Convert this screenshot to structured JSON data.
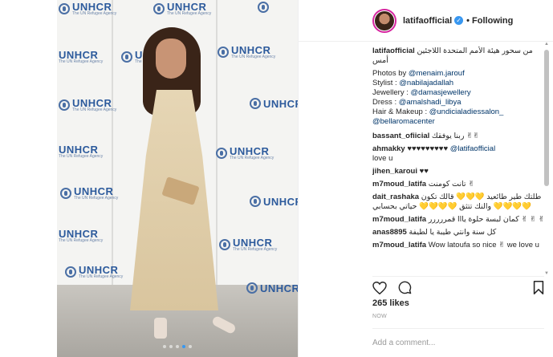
{
  "post": {
    "username": "latifaofficial",
    "follow_separator": "•",
    "follow_label": "Following",
    "caption": {
      "username": "latifaofficial",
      "text_arabic": "من سحور هيئة الأمم المتحدة اللاجئين أمس",
      "lines": [
        {
          "prefix": "Photos by ",
          "mention": "@menaim.jarouf"
        },
        {
          "prefix": "Stylist : ",
          "mention": "@nabilajadallah"
        },
        {
          "prefix": "Jewellery : ",
          "mention": "@damasjewellery"
        },
        {
          "prefix": "Dress : ",
          "mention": "@amalshadi_libya"
        },
        {
          "prefix": "Hair & Makeup : ",
          "mention": "@undicialadiessalon_"
        },
        {
          "prefix": "",
          "mention": "@bellaromacenter"
        }
      ]
    },
    "comments": [
      {
        "user": "bassant_ofiicial",
        "text": "ربنا يوفقك ✌✌"
      },
      {
        "user": "ahmakky",
        "text": "♥♥♥♥♥♥♥♥♥",
        "mention": "@latifaofficial",
        "text2": "love u"
      },
      {
        "user": "jihen_karoui",
        "text": "♥♥"
      },
      {
        "user": "m7moud_latifa",
        "text": "تانت كومنت ✌"
      },
      {
        "user": "dait_rashaka",
        "text": "طلتك طير طائعيد 💛💛💛 قالك تكون",
        "text2": "والنك تتثق 💛💛💛💛 حياتي بحسابي 💛💛💛💛"
      },
      {
        "user": "m7moud_latifa",
        "text": "كمان لبسة حلوة يااا قمررررر ✌ ✌ ✌"
      },
      {
        "user": "anas8895",
        "text": "كل سنة وانتي طيبة يا لطيفة"
      },
      {
        "user": "m7moud_latifa",
        "text": "Wow latoufa so nice ✌ we love u"
      }
    ],
    "likes": "265 likes",
    "timestamp": "NOW",
    "add_comment_placeholder": "Add a comment...",
    "carousel": {
      "count": 5,
      "active": 4
    }
  },
  "photo": {
    "backdrop_logo_main": "UNHCR",
    "backdrop_logo_sub": "The UN Refugee Agency"
  },
  "colors": {
    "accent": "#3897f0",
    "mention": "#003569",
    "unhcr_blue": "#2c5a9c"
  },
  "icons": [
    "verified-badge-icon",
    "heart-icon",
    "comment-icon",
    "bookmark-icon"
  ]
}
